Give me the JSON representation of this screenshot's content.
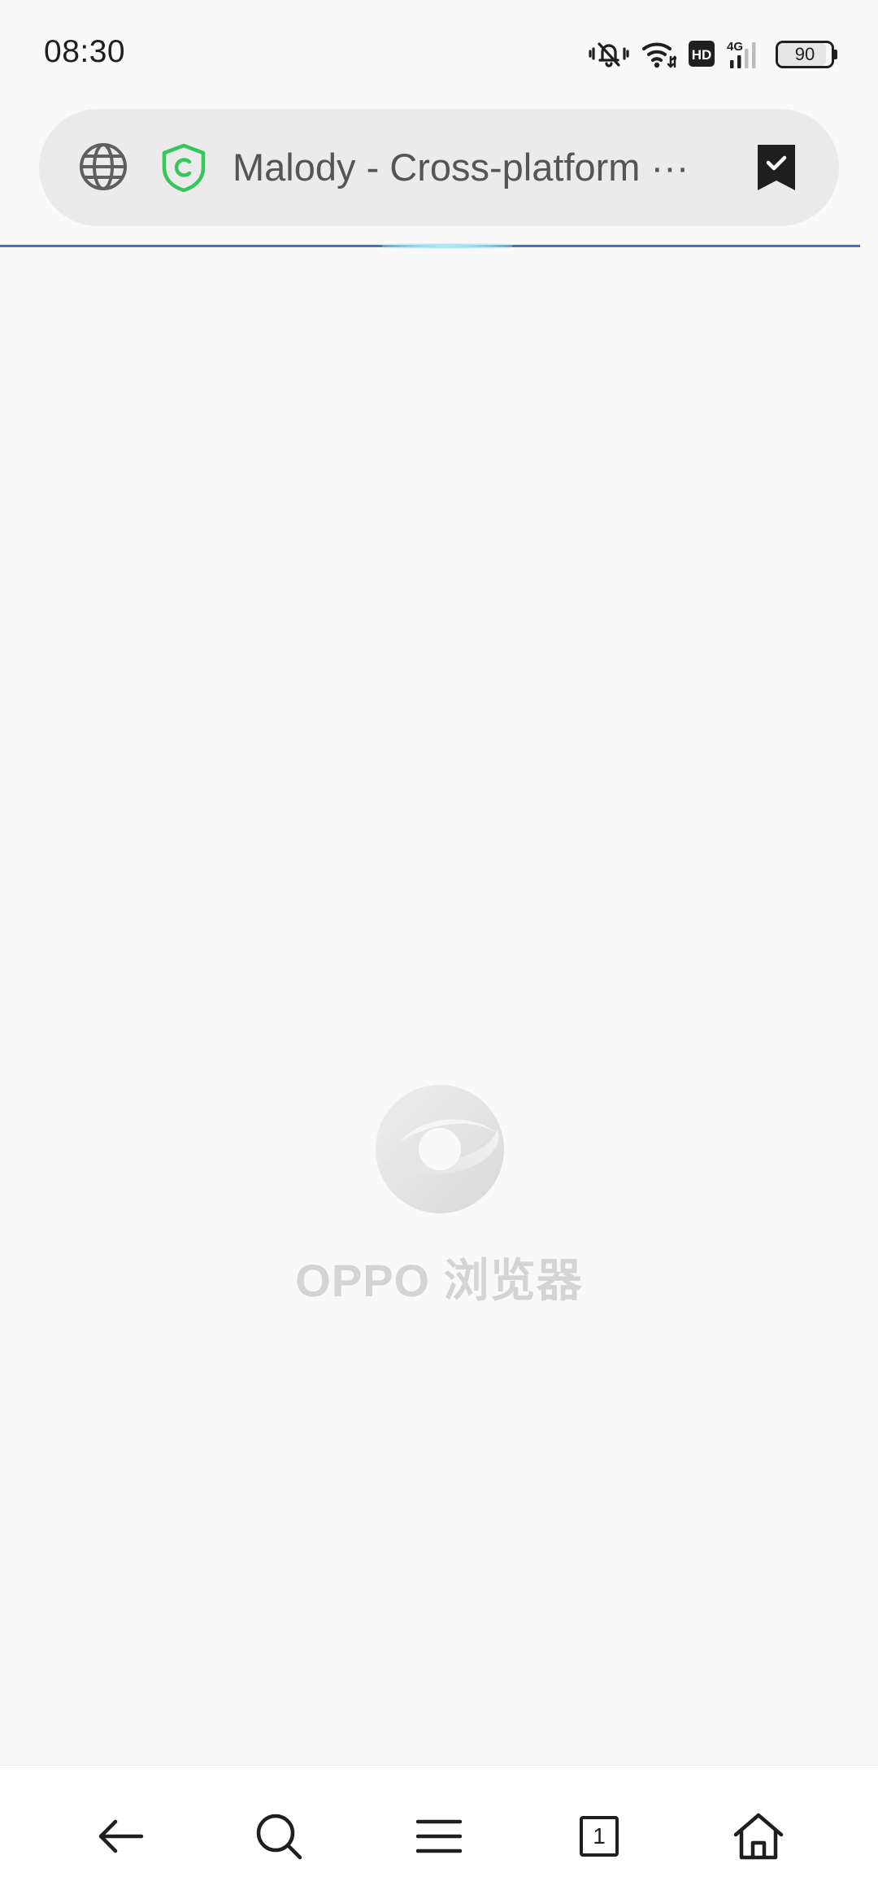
{
  "status_bar": {
    "time": "08:30",
    "network": "4G",
    "hd_label": "HD",
    "battery_level": 90,
    "battery_text": "90"
  },
  "url_bar": {
    "page_title": "Malody - Cross-platform ···",
    "icons": [
      "globe-icon",
      "security-shield-icon",
      "bookmark-icon"
    ],
    "shield_color": "#34c759"
  },
  "load_progress": 1.0,
  "splash": {
    "brand_text": "OPPO 浏览器"
  },
  "bottom_nav": {
    "tab_count": "1",
    "items": [
      "back-icon",
      "search-icon",
      "menu-icon",
      "tabs-icon",
      "home-icon"
    ]
  },
  "colors": {
    "accent": "#3f75c9",
    "background": "#f9f9f9",
    "url_bar_bg": "#ebebeb"
  }
}
